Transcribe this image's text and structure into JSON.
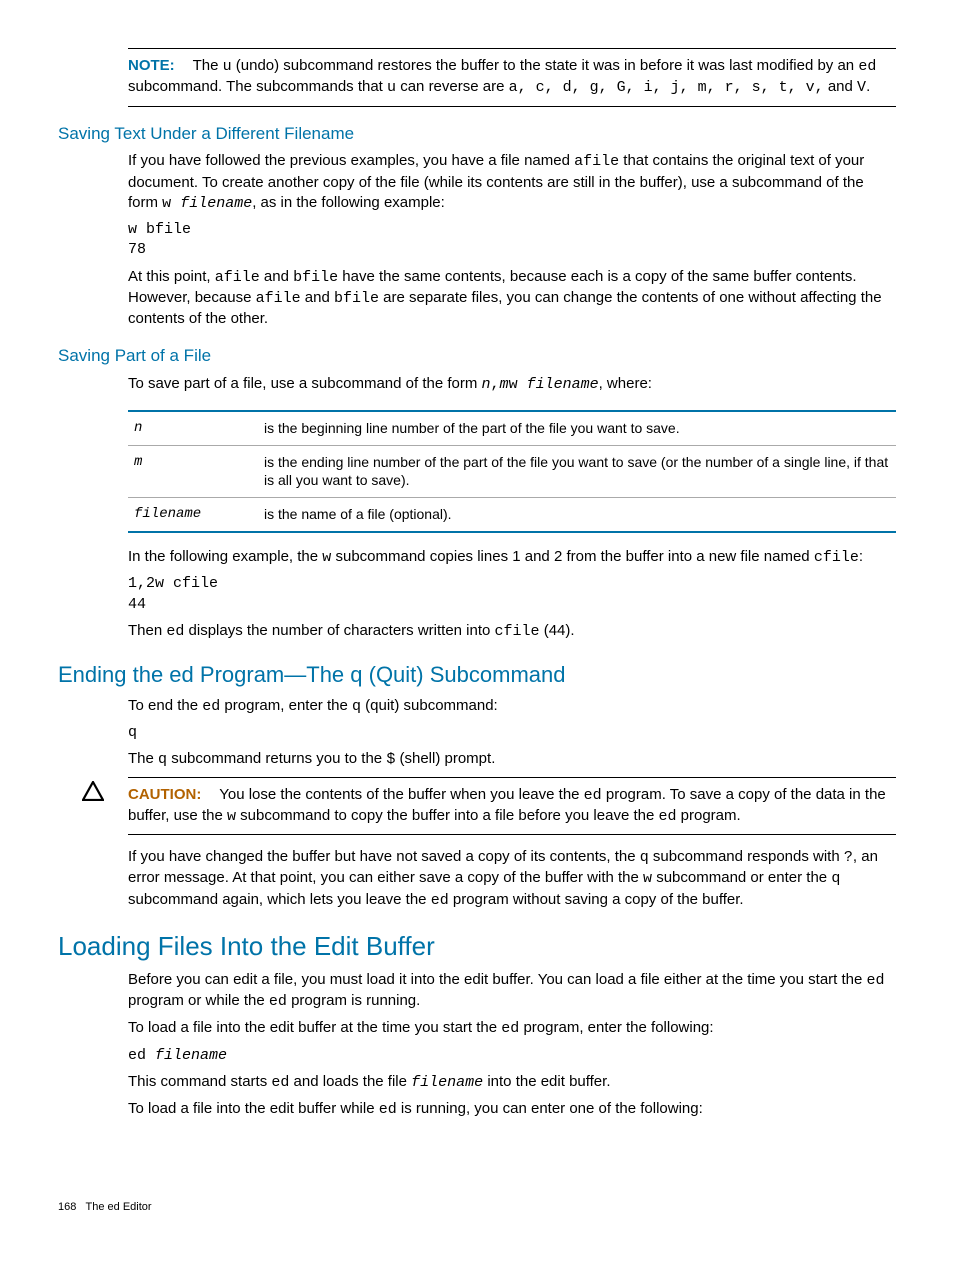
{
  "note": {
    "label": "NOTE:",
    "text_a": "The ",
    "u": "u",
    "text_b": " (undo) subcommand restores the buffer to the state it was in before it was last modified by an ",
    "ed": "ed",
    "text_c": " subcommand. The subcommands that ",
    "u2": "u",
    "text_d": " can reverse are ",
    "cmds": "a, c, d, g, G, i, j, m, r, s, t, v,",
    "text_e": " and ",
    "V": "V",
    "period": "."
  },
  "sec_save_diff": {
    "heading": "Saving Text Under a Different Filename",
    "p1_a": "If you have followed the previous examples, you have a file named ",
    "afile": "afile",
    "p1_b": " that contains the original text of your document. To create another copy of the file (while its contents are still in the buffer), use a subcommand of the form ",
    "w": "w ",
    "filename": "filename",
    "p1_c": ", as in the following example:",
    "code": "w bfile\n78",
    "p2_a": "At this point, ",
    "afile2": "afile",
    "p2_b": " and ",
    "bfile": "bfile",
    "p2_c": " have the same contents, because each is a copy of the same buffer contents. However, because ",
    "afile3": "afile",
    "p2_d": " and ",
    "bfile2": "bfile",
    "p2_e": " are separate files, you can change the contents of one without affecting the contents of the other."
  },
  "sec_save_part": {
    "heading": "Saving Part of a File",
    "p1_a": "To save part of a file, use a subcommand of the form ",
    "n": "n",
    "comma": ",",
    "m": "m",
    "w": "w ",
    "filename": "filename",
    "p1_b": ", where:",
    "rows": {
      "n_term": "n",
      "n_desc": "is the beginning line number of the part of the file you want to save.",
      "m_term": "m",
      "m_desc": "is the ending line number of the part of the file you want to save (or the number of a single line, if that is all you want to save).",
      "f_term": "filename",
      "f_desc": "is the name of a file (optional)."
    },
    "p2_a": "In the following example, the ",
    "w2": "w",
    "p2_b": " subcommand copies lines 1 and 2 from the buffer into a new file named ",
    "cfile": "cfile",
    "p2_c": ":",
    "code": "1,2w cfile\n44",
    "p3_a": "Then ",
    "ed": "ed",
    "p3_b": " displays the number of characters written into ",
    "cfile2": "cfile",
    "p3_c": " (44)."
  },
  "sec_quit": {
    "heading": "Ending the ed Program—The q (Quit) Subcommand",
    "p1_a": "To end the ",
    "ed": "ed",
    "p1_b": " program, enter the ",
    "q": "q",
    "p1_c": " (quit) subcommand:",
    "code": "q",
    "p2_a": "The ",
    "q2": "q",
    "p2_b": " subcommand returns you to the ",
    "dollar": "$",
    "p2_c": " (shell) prompt.",
    "caution": {
      "label": "CAUTION:",
      "a": "You lose the contents of the buffer when you leave the ",
      "ed": "ed",
      "b": " program. To save a copy of the data in the buffer, use the ",
      "w": "w",
      "c": " subcommand to copy the buffer into a file before you leave the ",
      "ed2": "ed",
      "d": " program."
    },
    "p3_a": "If you have changed the buffer but have not saved a copy of its contents, the ",
    "q3": "q",
    "p3_b": " subcommand responds with ",
    "qmark": "?",
    "p3_c": ", an error message. At that point, you can either save a copy of the buffer with the ",
    "w3": "w",
    "p3_d": " subcommand or enter the ",
    "q4": "q",
    "p3_e": " subcommand again, which lets you leave the ",
    "ed3": "ed",
    "p3_f": " program without saving a copy of the buffer."
  },
  "sec_load": {
    "heading": "Loading Files Into the Edit Buffer",
    "p1_a": "Before you can edit a file, you must load it into the edit buffer. You can load a file either at the time you start the ",
    "ed": "ed",
    "p1_b": " program or while the ",
    "ed2": "ed",
    "p1_c": " program is running.",
    "p2_a": "To load a file into the edit buffer at the time you start the ",
    "ed3": "ed",
    "p2_b": " program, enter the following:",
    "code_a": "ed ",
    "code_b": "filename",
    "p3_a": "This command starts ",
    "ed4": "ed",
    "p3_b": " and loads the file ",
    "filename": "filename",
    "p3_c": " into the edit buffer.",
    "p4_a": "To load a file into the edit buffer while ",
    "ed5": "ed",
    "p4_b": " is running, you can enter one of the following:"
  },
  "footer": {
    "page": "168",
    "title": "The ed Editor"
  }
}
